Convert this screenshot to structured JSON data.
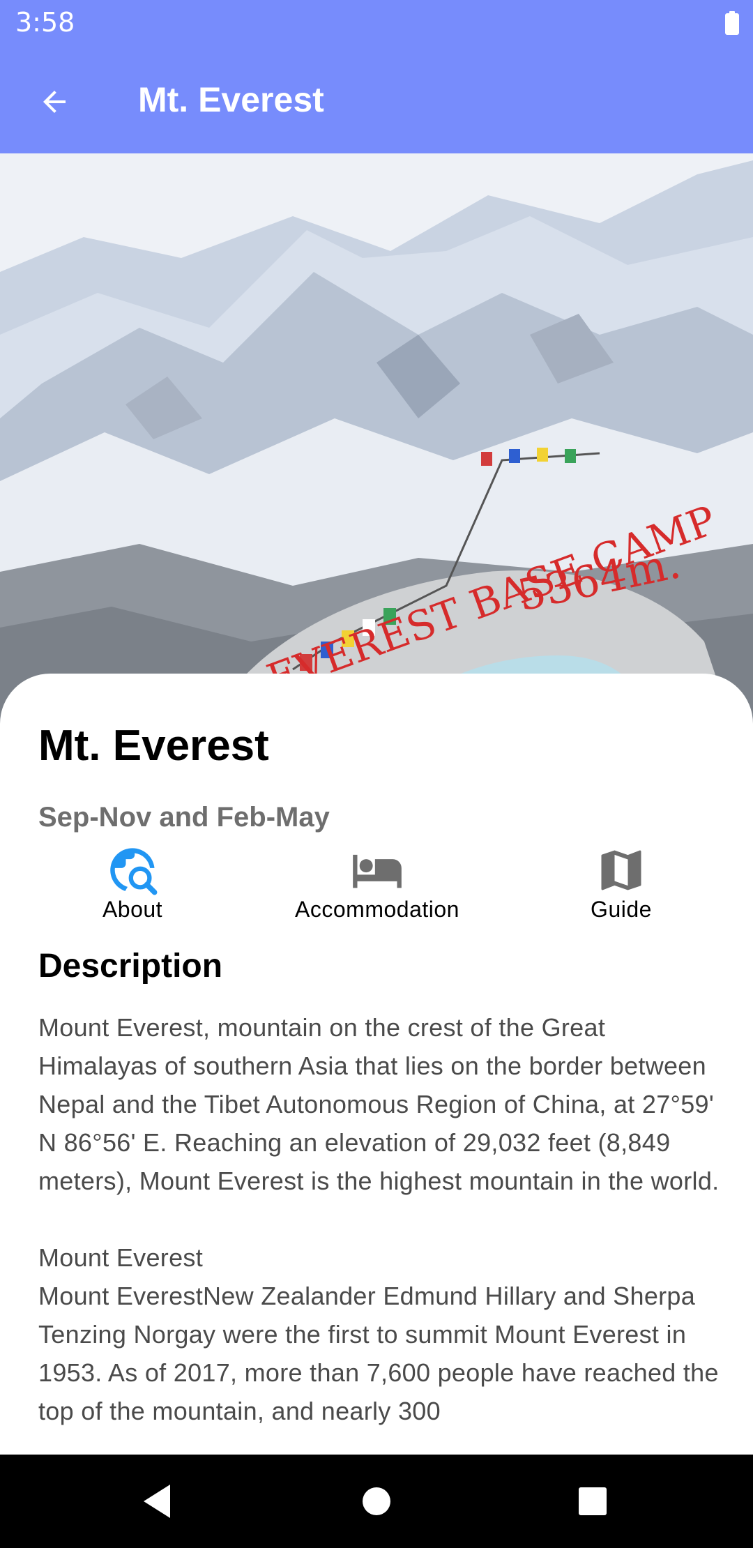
{
  "status_bar": {
    "time": "3:58",
    "battery_icon": "battery-full-icon"
  },
  "app_bar": {
    "back_icon": "arrow-back-icon",
    "title": "Mt. Everest",
    "color": "#778cfc"
  },
  "hero": {
    "image": "everest-base-camp-photo",
    "sign_text": "EVEREST BASE CAMP",
    "sign_elevation": "5364m."
  },
  "details": {
    "title": "Mt. Everest",
    "season": "Sep-Nov and Feb-May"
  },
  "tabs": [
    {
      "label": "About",
      "icon": "travel-explore-icon",
      "active": true,
      "color": "#2196f3"
    },
    {
      "label": "Accommodation",
      "icon": "bed-icon",
      "active": false,
      "color": "#6e6e6e"
    },
    {
      "label": "Guide",
      "icon": "map-icon",
      "active": false,
      "color": "#6e6e6e"
    }
  ],
  "description": {
    "heading": "Description",
    "body": "Mount Everest, mountain on the crest of the Great Himalayas of southern Asia that lies on the border between Nepal and the Tibet Autonomous Region of China, at 27°59' N 86°56' E. Reaching an elevation of 29,032 feet (8,849 meters), Mount Everest is the highest mountain in the world.\n\nMount Everest\nMount EverestNew Zealander Edmund Hillary and Sherpa Tenzing Norgay were the first to summit Mount Everest in 1953. As of 2017, more than 7,600 people have reached the top of the mountain, and nearly 300"
  },
  "nav_bar": {
    "back": "nav-back-icon",
    "home": "nav-home-icon",
    "recents": "nav-recents-icon"
  }
}
